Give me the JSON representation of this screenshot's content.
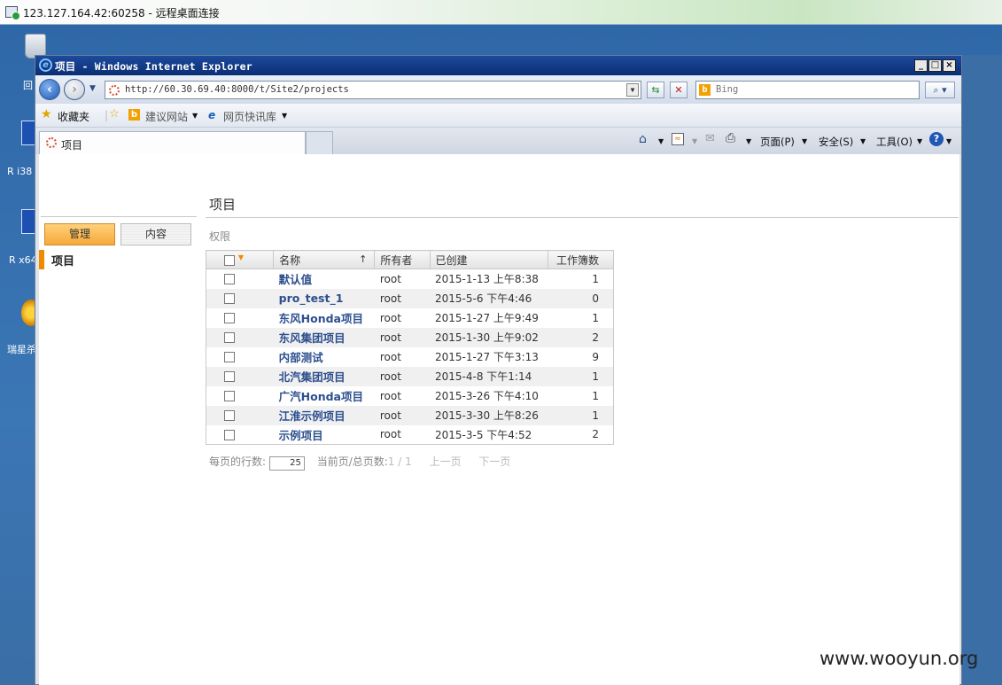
{
  "rdp": {
    "title": "123.127.164.42:60258 - 远程桌面连接"
  },
  "desktop": {
    "icons": [
      {
        "label": "回",
        "icon": "recycle-bin-icon"
      },
      {
        "label": "R i38",
        "icon": "shortcut-icon"
      },
      {
        "label": "R x64",
        "icon": "shortcut-icon"
      },
      {
        "label": "瑞星杀",
        "icon": "antivirus-icon"
      }
    ]
  },
  "browser": {
    "title": "项目 - Windows Internet Explorer",
    "window_buttons": [
      "_",
      "□",
      "×"
    ],
    "address": "http://60.30.69.40:8000/t/Site2/projects",
    "search_placeholder": "Bing",
    "favorites": {
      "label": "收藏夹",
      "suggested": "建议网站",
      "webslice": "网页快讯库"
    },
    "tab": {
      "label": "项目"
    },
    "commands": {
      "page": "页面(P)",
      "safety": "安全(S)",
      "tools": "工具(O)"
    }
  },
  "page": {
    "title": "项目",
    "buttons": {
      "admin": "管理",
      "content": "内容"
    },
    "nav": {
      "projects": "项目"
    },
    "permissions_link": "权限",
    "table": {
      "headers": {
        "name": "名称",
        "owner": "所有者",
        "created": "已创建",
        "workbooks": "工作簿数"
      },
      "rows": [
        {
          "name": "默认值",
          "owner": "root",
          "created": "2015-1-13 上午8:38",
          "count": "1"
        },
        {
          "name": "pro_test_1",
          "owner": "root",
          "created": "2015-5-6 下午4:46",
          "count": "0"
        },
        {
          "name": "东风Honda项目",
          "owner": "root",
          "created": "2015-1-27 上午9:49",
          "count": "1"
        },
        {
          "name": "东风集团项目",
          "owner": "root",
          "created": "2015-1-30 上午9:02",
          "count": "2"
        },
        {
          "name": "内部测试",
          "owner": "root",
          "created": "2015-1-27 下午3:13",
          "count": "9"
        },
        {
          "name": "北汽集团项目",
          "owner": "root",
          "created": "2015-4-8 下午1:14",
          "count": "1"
        },
        {
          "name": "广汽Honda项目",
          "owner": "root",
          "created": "2015-3-26 下午4:10",
          "count": "1"
        },
        {
          "name": "江淮示例项目",
          "owner": "root",
          "created": "2015-3-30 上午8:26",
          "count": "1"
        },
        {
          "name": "示例项目",
          "owner": "root",
          "created": "2015-3-5 下午4:52",
          "count": "2"
        }
      ]
    },
    "pager": {
      "rows_per_page_label": "每页的行数:",
      "rows_per_page_value": "25",
      "page_label": "当前页/总页数:",
      "page_value": "1 / 1",
      "prev": "上一页",
      "next": "下一页"
    }
  },
  "watermark": "www.wooyun.org"
}
